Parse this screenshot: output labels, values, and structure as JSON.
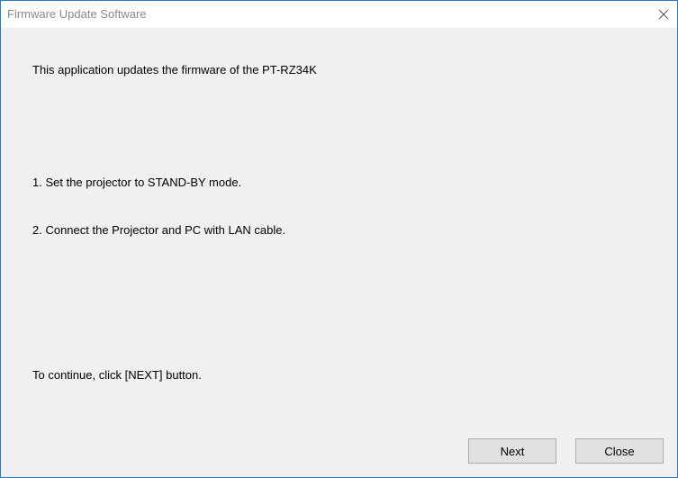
{
  "window": {
    "title": "Firmware Update Software",
    "close_icon": "close-icon"
  },
  "content": {
    "intro": "This application updates the firmware of the PT-RZ34K",
    "step1": "1. Set the projector to STAND-BY mode.",
    "step2": "2. Connect the Projector and PC with LAN cable.",
    "instruction": "To continue, click [NEXT] button."
  },
  "buttons": {
    "next_label": "Next",
    "close_label": "Close"
  },
  "colors": {
    "window_border": "#2b79c8",
    "client_bg": "#f0f0f0",
    "button_bg": "#e1e1e1"
  }
}
